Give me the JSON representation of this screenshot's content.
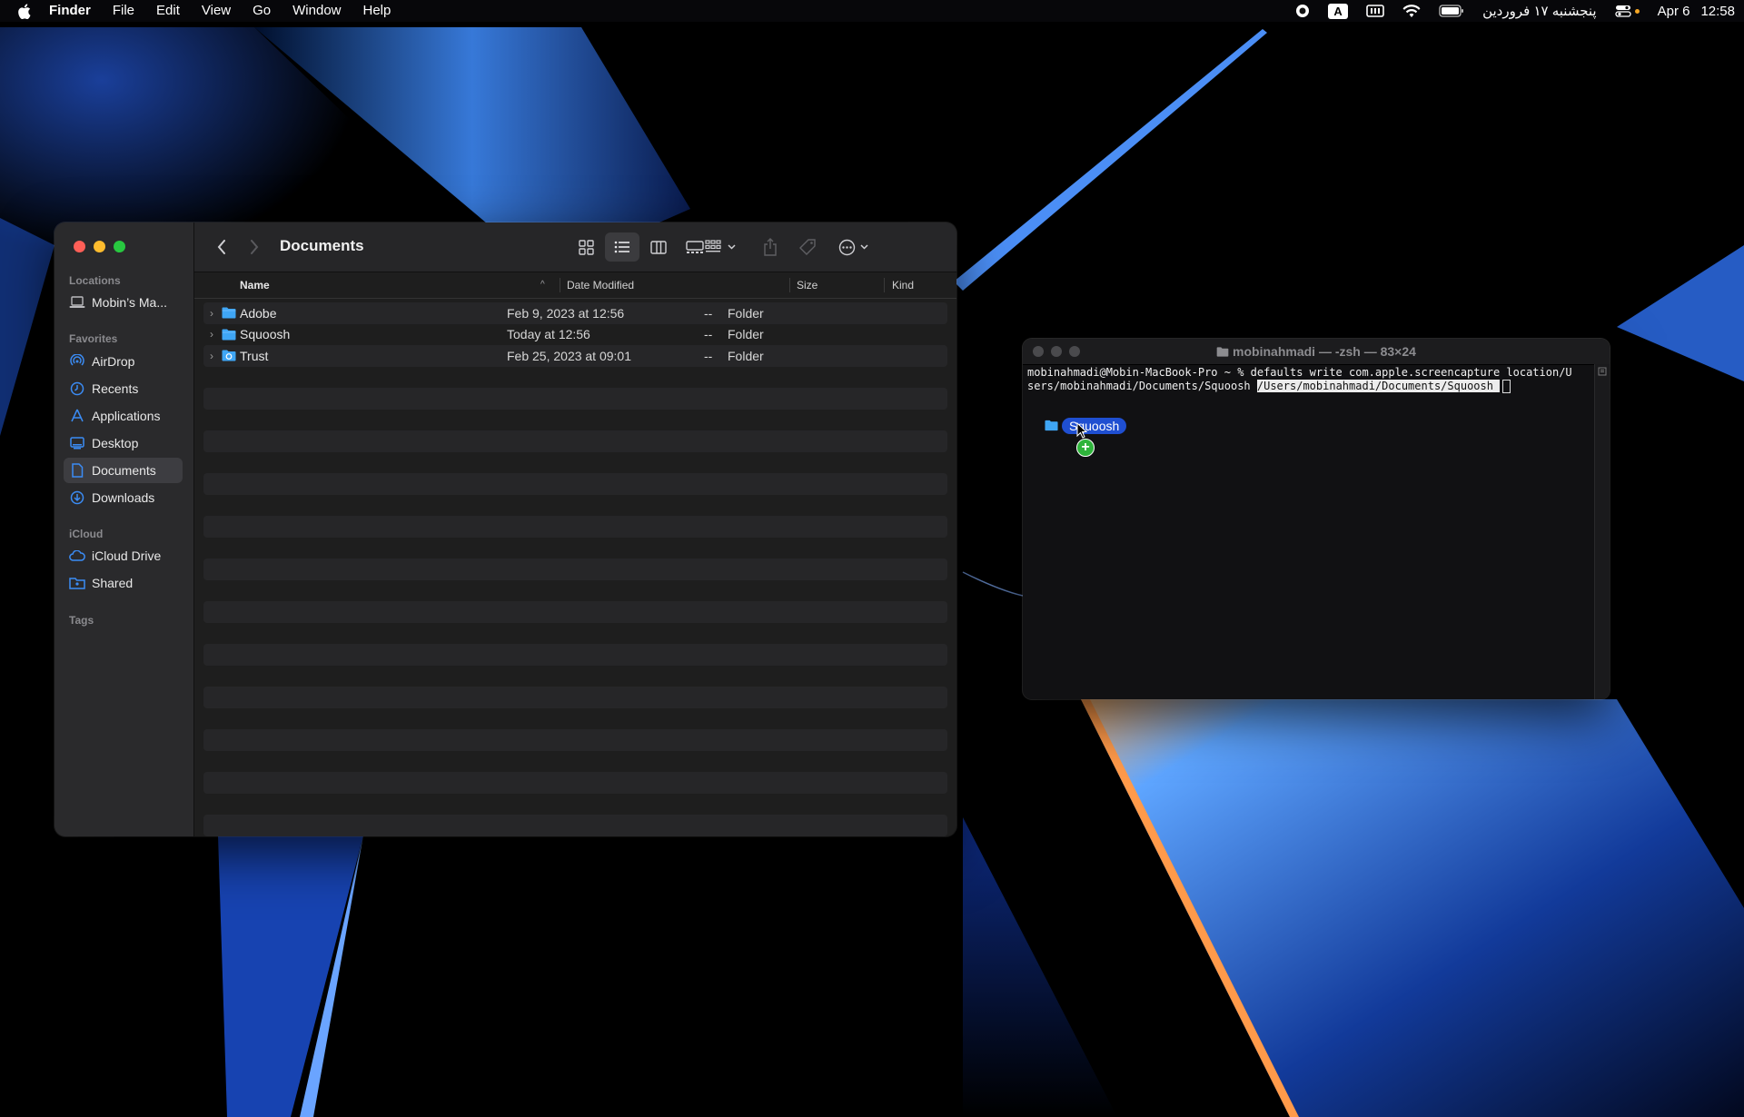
{
  "menubar": {
    "app_name": "Finder",
    "menus": [
      "File",
      "Edit",
      "View",
      "Go",
      "Window",
      "Help"
    ],
    "input_source": "A",
    "persian_date": "پنجشنبه ۱۷ فروردین",
    "date": "Apr 6",
    "time": "12:58"
  },
  "finder": {
    "title": "Documents",
    "sidebar": {
      "locations_header": "Locations",
      "locations": [
        {
          "label": "Mobin’s Ma...",
          "icon": "laptop-icon"
        }
      ],
      "favorites_header": "Favorites",
      "favorites": [
        {
          "label": "AirDrop",
          "icon": "airdrop-icon"
        },
        {
          "label": "Recents",
          "icon": "clock-icon"
        },
        {
          "label": "Applications",
          "icon": "applications-icon"
        },
        {
          "label": "Desktop",
          "icon": "desktop-icon"
        },
        {
          "label": "Documents",
          "icon": "document-icon",
          "selected": true
        },
        {
          "label": "Downloads",
          "icon": "download-icon"
        }
      ],
      "icloud_header": "iCloud",
      "icloud": [
        {
          "label": "iCloud Drive",
          "icon": "cloud-icon"
        },
        {
          "label": "Shared",
          "icon": "shared-folder-icon"
        }
      ],
      "tags_header": "Tags"
    },
    "columns": {
      "name": "Name",
      "date": "Date Modified",
      "size": "Size",
      "kind": "Kind"
    },
    "files": [
      {
        "name": "Adobe",
        "date": "Feb 9, 2023 at 12:56",
        "size": "--",
        "kind": "Folder"
      },
      {
        "name": "Squoosh",
        "date": "Today at 12:56",
        "size": "--",
        "kind": "Folder"
      },
      {
        "name": "Trust",
        "date": "Feb 25, 2023 at 09:01",
        "size": "--",
        "kind": "Folder"
      }
    ]
  },
  "terminal": {
    "title": "mobinahmadi — -zsh — 83×24",
    "line1": "mobinahmadi@Mobin-MacBook-Pro ~ % defaults write com.apple.screencapture location/U",
    "line2_plain": "sers/mobinahmadi/Documents/Squoosh ",
    "line2_selected": "/Users/mobinahmadi/Documents/Squoosh "
  },
  "drag": {
    "label": "Squoosh"
  },
  "colors": {
    "accent": "#1f4fd1",
    "close": "#ff5f57",
    "minimize": "#febc2e",
    "zoom": "#28c840",
    "folder_blue": "#3fa6f5"
  }
}
